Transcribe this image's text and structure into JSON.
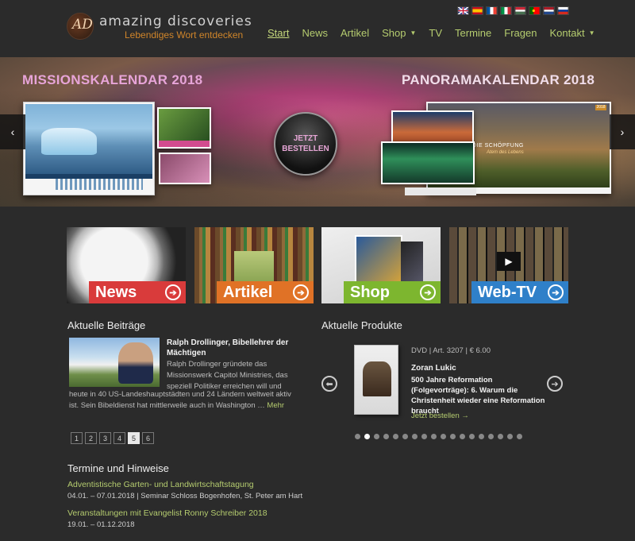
{
  "header": {
    "logo_text": "AD",
    "brand_title": "amazing discoveries",
    "brand_subtitle": "Lebendiges Wort entdecken",
    "flags": [
      {
        "name": "flag-uk",
        "colors": [
          "#2b3b8f",
          "#c8102e"
        ]
      },
      {
        "name": "flag-spain",
        "colors": [
          "#c60b1e",
          "#ffc400"
        ]
      },
      {
        "name": "flag-france",
        "colors": [
          "#0055a4",
          "#ffffff",
          "#ef4135"
        ]
      },
      {
        "name": "flag-italy",
        "colors": [
          "#009246",
          "#ffffff",
          "#ce2b37"
        ]
      },
      {
        "name": "flag-hungary",
        "colors": [
          "#ce2939",
          "#ffffff",
          "#477050"
        ]
      },
      {
        "name": "flag-portugal",
        "colors": [
          "#006600",
          "#ff0000"
        ]
      },
      {
        "name": "flag-netherlands",
        "colors": [
          "#ae1c28",
          "#ffffff",
          "#21468b"
        ]
      },
      {
        "name": "flag-russia",
        "colors": [
          "#ffffff",
          "#0039a6",
          "#d52b1e"
        ]
      }
    ],
    "nav": [
      {
        "label": "Start",
        "active": true,
        "dropdown": false
      },
      {
        "label": "News",
        "active": false,
        "dropdown": false
      },
      {
        "label": "Artikel",
        "active": false,
        "dropdown": false
      },
      {
        "label": "Shop",
        "active": false,
        "dropdown": true
      },
      {
        "label": "TV",
        "active": false,
        "dropdown": false
      },
      {
        "label": "Termine",
        "active": false,
        "dropdown": false
      },
      {
        "label": "Fragen",
        "active": false,
        "dropdown": false
      },
      {
        "label": "Kontakt",
        "active": false,
        "dropdown": true
      }
    ]
  },
  "banner": {
    "title_left": "MISSIONSKALENDAR 2018",
    "title_right": "PANORAMAKALENDAR 2018",
    "order_line1": "JETZT",
    "order_line2": "BESTELLEN",
    "calendar_caption": "DIE SCHÖPFUNG",
    "calendar_subcaption": "Atem des Lebens",
    "calendar_year": "2018",
    "prev_icon": "‹",
    "next_icon": "›"
  },
  "tiles": [
    {
      "label": "News",
      "color": "#d93b3b"
    },
    {
      "label": "Artikel",
      "color": "#e07226"
    },
    {
      "label": "Shop",
      "color": "#7db62f"
    },
    {
      "label": "Web-TV",
      "color": "#2f80c9"
    }
  ],
  "posts": {
    "section_title": "Aktuelle Beiträge",
    "title": "Ralph Drollinger, Bibellehrer der Mächtigen",
    "text_side": "Ralph Drollinger gründete das Missionswerk Capitol Ministries, das speziell Politiker erreichen will und",
    "text_full": "heute in 40 US-Landeshauptstädten und 24 Ländern weltweit aktiv ist. Sein Bibeldienst hat mittlerweile auch in Washington …",
    "more_label": "Mehr",
    "pages": [
      "1",
      "2",
      "3",
      "4",
      "5",
      "6"
    ],
    "active_page": "5"
  },
  "products": {
    "section_title": "Aktuelle Produkte",
    "meta": "DVD | Art. 3207 | € 6.00",
    "author": "Zoran Lukic",
    "title": "500 Jahre Reformation (Folgevorträge): 6. Warum die Christenheit wieder eine Reformation braucht",
    "order_label": "Jetzt bestellen →",
    "dot_count": 18,
    "active_dot": 2
  },
  "events": {
    "section_title": "Termine und Hinweise",
    "items": [
      {
        "title": "Adventistische Garten- und Landwirtschaftstagung",
        "date": "04.01. – 07.01.2018",
        "location": "Seminar Schloss Bogenhofen, St. Peter am Hart"
      },
      {
        "title": "Veranstaltungen mit Evangelist Ronny Schreiber 2018",
        "date": "19.01. – 01.12.2018",
        "location": ""
      }
    ]
  }
}
